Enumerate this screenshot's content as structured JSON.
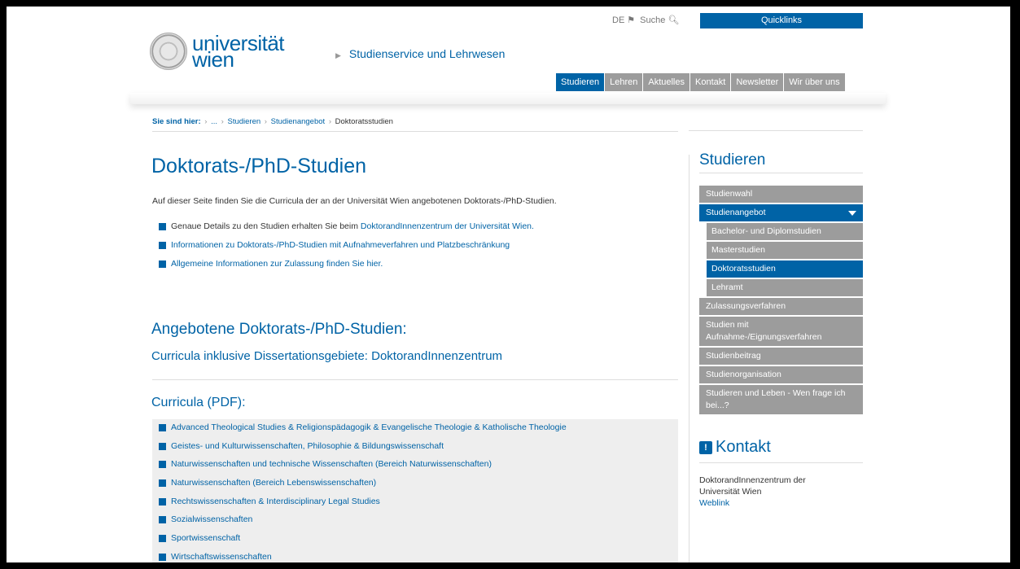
{
  "header": {
    "lang": "DE",
    "search": "Suche",
    "quicklinks": "Quicklinks",
    "logo_line1": "universität",
    "logo_line2": "wien",
    "subsite": "Studienservice und Lehrwesen",
    "nav": [
      "Studieren",
      "Lehren",
      "Aktuelles",
      "Kontakt",
      "Newsletter",
      "Wir über uns"
    ]
  },
  "breadcrumb": {
    "label": "Sie sind hier:",
    "items": [
      "...",
      "Studieren",
      "Studienangebot"
    ],
    "current": "Doktoratsstudien"
  },
  "main": {
    "title": "Doktorats-/PhD-Studien",
    "intro": "Auf dieser Seite finden Sie die Curricula der an der Universität Wien angebotenen Doktorats-/PhD-Studien.",
    "bullet1_text": "Genaue Details zu den Studien erhalten Sie beim ",
    "bullet1_link": "DoktorandInnenzentrum der Universität Wien.",
    "bullet2": "Informationen zu Doktorats-/PhD-Studien mit Aufnahmeverfahren und Platzbeschränkung",
    "bullet3": "Allgemeine Informationen zur Zulassung finden Sie hier.",
    "h2": "Angebotene Doktorats-/PhD-Studien:",
    "h3": "Curricula inklusive Dissertationsgebiete: DoktorandInnenzentrum",
    "h4": "Curricula (PDF):",
    "curricula": [
      "Advanced Theological Studies & Religionspädagogik & Evangelische Theologie & Katholische Theologie",
      "Geistes- und Kulturwissenschaften, Philosophie & Bildungswissenschaft",
      "Naturwissenschaften und technische Wissenschaften (Bereich Naturwissenschaften)",
      "Naturwissenschaften (Bereich Lebenswissenschaften)",
      "Rechtswissenschaften & Interdisciplinary Legal Studies",
      "Sozialwissenschaften",
      "Sportwissenschaft",
      "Wirtschaftswissenschaften"
    ]
  },
  "sidebar": {
    "title": "Studieren",
    "items": [
      "Studienwahl",
      "Studienangebot",
      "Bachelor- und Diplomstudien",
      "Masterstudien",
      "Doktoratsstudien",
      "Lehramt",
      "Zulassungsverfahren",
      "Studien mit Aufnahme-/Eignungsverfahren",
      "Studienbeitrag",
      "Studienorganisation",
      "Studieren und Leben - Wen frage ich bei...?"
    ],
    "kontakt_title": "Kontakt",
    "kontakt_text": "DoktorandInnenzentrum der Universität Wien",
    "kontakt_link": "Weblink"
  },
  "colors": {
    "brand": "#0063a6",
    "menu_grey": "#9c9c9c"
  }
}
